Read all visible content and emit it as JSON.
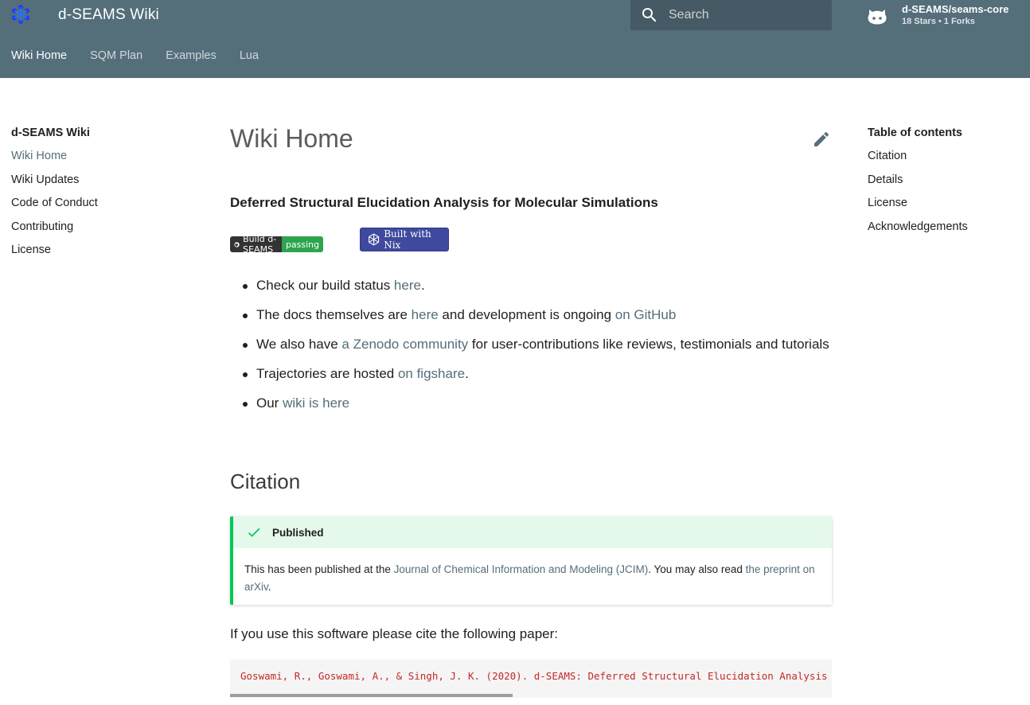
{
  "header": {
    "site_title": "d-SEAMS Wiki",
    "search_placeholder": "Search",
    "repo_name": "d-SEAMS/seams-core",
    "repo_stats": "18 Stars • 1 Forks",
    "tabs": [
      {
        "label": "Wiki Home",
        "active": true
      },
      {
        "label": "SQM Plan",
        "active": false
      },
      {
        "label": "Examples",
        "active": false
      },
      {
        "label": "Lua",
        "active": false
      }
    ]
  },
  "left_nav": {
    "title": "d-SEAMS Wiki",
    "items": [
      {
        "label": "Wiki Home",
        "active": true
      },
      {
        "label": "Wiki Updates",
        "active": false
      },
      {
        "label": "Code of Conduct",
        "active": false
      },
      {
        "label": "Contributing",
        "active": false
      },
      {
        "label": "License",
        "active": false
      }
    ]
  },
  "toc": {
    "title": "Table of contents",
    "items": [
      "Citation",
      "Details",
      "License",
      "Acknowledgements"
    ]
  },
  "main": {
    "title": "Wiki Home",
    "subtitle": "Deferred Structural Elucidation Analysis for Molecular Simulations",
    "badges": {
      "build_left": "Build d-SEAMS",
      "build_right": "passing",
      "nix": "Built with Nix"
    },
    "bullets": {
      "b1_pre": "Check our build status ",
      "b1_link": "here",
      "b1_post": ".",
      "b2_pre": "The docs themselves are ",
      "b2_link1": "here",
      "b2_mid": " and development is ongoing ",
      "b2_link2": "on GitHub",
      "b3_pre": "We also have ",
      "b3_link": "a Zenodo community",
      "b3_post": " for user-contributions like reviews, testimonials and tutorials",
      "b4_pre": "Trajectories are hosted ",
      "b4_link": "on figshare",
      "b4_post": ".",
      "b5_pre": "Our ",
      "b5_link": "wiki is here"
    },
    "citation": {
      "heading": "Citation",
      "admonition_title": "Published",
      "adm_pre": "This has been published at the ",
      "adm_link1": "Journal of Chemical Information and Modeling (JCIM)",
      "adm_mid": ". You may also read ",
      "adm_link2": "the preprint on arXiv",
      "adm_post": ".",
      "cite_text": "If you use this software please cite the following paper:",
      "code": "Goswami, R., Goswami, A., & Singh, J. K. (2020). d-SEAMS: Deferred Structural Elucidation Analysis for Molecular Simulations."
    }
  },
  "colors": {
    "primary": "#546e7a",
    "accent_success": "#00c853",
    "code_text": "#c62828"
  }
}
